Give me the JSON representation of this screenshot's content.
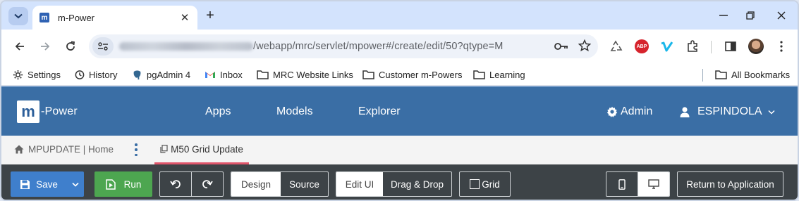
{
  "browser": {
    "tab_title": "m-Power",
    "favicon_letter": "m",
    "url_visible": "/webapp/mrc/servlet/mpower#/create/edit/50?qtype=M",
    "abp_label": "ABP"
  },
  "bookmarks": [
    {
      "label": "Settings",
      "icon": "gear-icon"
    },
    {
      "label": "History",
      "icon": "history-icon"
    },
    {
      "label": "pgAdmin 4",
      "icon": "elephant-icon"
    },
    {
      "label": "Inbox",
      "icon": "gmail-icon"
    },
    {
      "label": "MRC Website Links",
      "icon": "folder-icon"
    },
    {
      "label": "Customer m-Powers",
      "icon": "folder-icon"
    },
    {
      "label": "Learning",
      "icon": "folder-icon"
    },
    {
      "label": "All Bookmarks",
      "icon": "folder-icon"
    }
  ],
  "app": {
    "logo_letter": "m",
    "logo_text": "-Power",
    "nav": [
      "Apps",
      "Models",
      "Explorer"
    ],
    "admin_label": "Admin",
    "user_label": "ESPINDOLA"
  },
  "breadcrumb": {
    "home_label": "MPUPDATE | Home",
    "active_tab": "M50 Grid Update"
  },
  "editor_toolbar": {
    "save": "Save",
    "run": "Run",
    "design": "Design",
    "source": "Source",
    "edit_ui": "Edit UI",
    "drag_drop": "Drag & Drop",
    "grid": "Grid",
    "return": "Return to Application"
  },
  "colors": {
    "app_header": "#3a6ea5",
    "editor_bar": "#3d4347",
    "save_button": "#3f7fcc",
    "run_button": "#4da650",
    "active_tab_underline": "#e0566b"
  }
}
